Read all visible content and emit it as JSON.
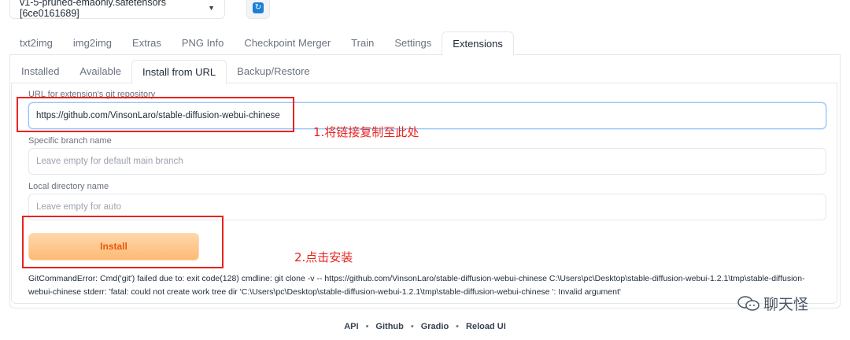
{
  "model": {
    "selected": "v1-5-pruned-emaonly.safetensors [6ce0161689]",
    "arrow": "▼",
    "refresh_icon": "↻"
  },
  "main_tabs": [
    "txt2img",
    "img2img",
    "Extras",
    "PNG Info",
    "Checkpoint Merger",
    "Train",
    "Settings",
    "Extensions"
  ],
  "sub_tabs": [
    "Installed",
    "Available",
    "Install from URL",
    "Backup/Restore"
  ],
  "form": {
    "url_label": "URL for extension's git repository",
    "url_value": "https://github.com/VinsonLaro/stable-diffusion-webui-chinese",
    "branch_label": "Specific branch name",
    "branch_placeholder": "Leave empty for default main branch",
    "dir_label": "Local directory name",
    "dir_placeholder": "Leave empty for auto",
    "install_label": "Install"
  },
  "error": "GitCommandError: Cmd('git') failed due to: exit code(128) cmdline: git clone -v -- https://github.com/VinsonLaro/stable-diffusion-webui-chinese C:\\Users\\pc\\Desktop\\stable-diffusion-webui-1.2.1\\tmp\\stable-diffusion-webui-chinese stderr: 'fatal: could not create work tree dir 'C:\\Users\\pc\\Desktop\\stable-diffusion-webui-1.2.1\\tmp\\stable-diffusion-webui-chinese ': Invalid argument'",
  "annotations": {
    "step1": "1.将链接复制至此处",
    "step2": "2.点击安装"
  },
  "footer": {
    "links": [
      "API",
      "Github",
      "Gradio",
      "Reload UI"
    ],
    "separator": "•"
  },
  "watermark": "聊天怪",
  "colors": {
    "annotation": "#e8231e",
    "install_text": "#ea580c",
    "install_bg": "#fdba74",
    "refresh": "#1d7fd6"
  }
}
